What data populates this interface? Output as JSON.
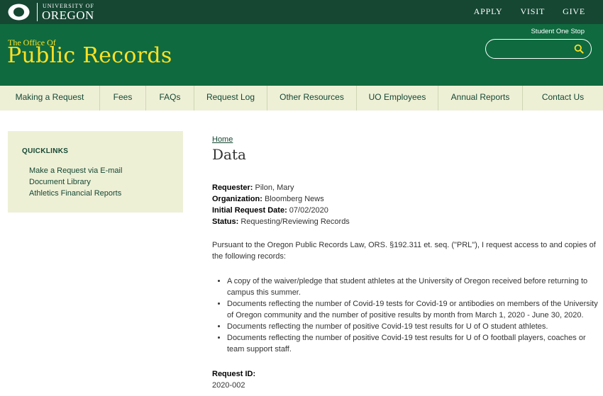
{
  "brand": {
    "university_small": "UNIVERSITY OF",
    "university_big": "OREGON",
    "site_small": "The Office Of",
    "site_big": "Public Records",
    "green_dark": "#154733",
    "green": "#0f6a3f",
    "yellow": "#fee123",
    "nav_bg": "#eef0d6"
  },
  "top_links": [
    "APPLY",
    "VISIT",
    "GIVE"
  ],
  "header": {
    "student_link": "Student One Stop",
    "search_placeholder": ""
  },
  "nav": [
    "Making a Request",
    "Fees",
    "FAQs",
    "Request Log",
    "Other Resources",
    "UO Employees",
    "Annual Reports",
    "Contact Us"
  ],
  "sidebar": {
    "title": "QUICKLINKS",
    "items": [
      "Make a Request via E-mail",
      "Document Library",
      "Athletics Financial Reports"
    ]
  },
  "main": {
    "breadcrumb": "Home",
    "title": "Data",
    "fields": [
      {
        "label": "Requester:",
        "value": " Pilon, Mary"
      },
      {
        "label": "Organization:",
        "value": " Bloomberg News"
      },
      {
        "label": "Initial Request Date:",
        "value": " 07/02/2020"
      },
      {
        "label": "Status:",
        "value": " Requesting/Reviewing Records"
      }
    ],
    "paragraph": "Pursuant to the Oregon Public Records Law, ORS. §192.311 et. seq. (\"PRL\"), I request access to and copies of the following records:",
    "bullets": [
      "A copy of the waiver/pledge that student athletes at the University of Oregon received before returning to campus this summer.",
      "Documents reflecting the number of Covid-19 tests for Covid-19 or antibodies on members of the University of Oregon community and the number of positive results by month from March 1, 2020 - June 30, 2020.",
      "Documents reflecting the number of positive Covid-19 test results for U of O student athletes.",
      "Documents reflecting the number of positive Covid-19 test results for U of O football players, coaches or team support staff."
    ],
    "request_id_label": "Request ID:",
    "request_id_value": "2020-002"
  }
}
